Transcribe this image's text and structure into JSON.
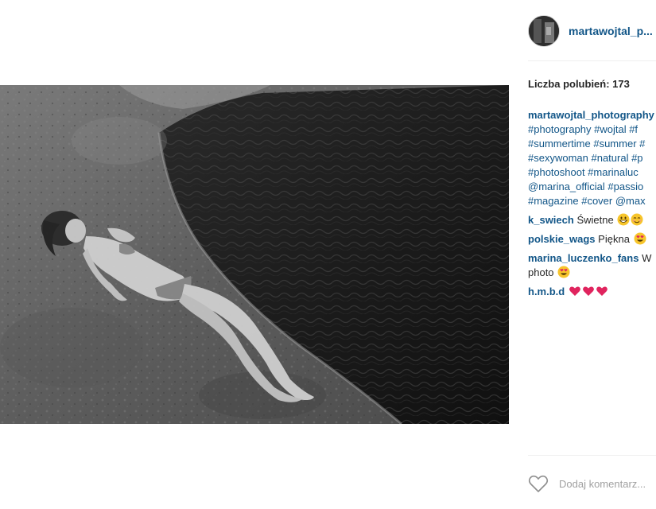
{
  "post": {
    "username": "martawojtal_p...",
    "likes_label": "Liczba polubień: 173",
    "caption_lines": [
      "martawojtal_photography",
      "#photography #wojtal #f",
      "#summertime #summer #",
      "#sexywoman #natural #p",
      "#photoshoot #marinaluc",
      "@marina_official #passio",
      "#magazine #cover @max"
    ],
    "comments": [
      {
        "user": "k_swiech",
        "text": "Świetne",
        "emoji": [
          "grin-emoji",
          "smile-emoji"
        ]
      },
      {
        "user": "polskie_wags",
        "text": "Piękna",
        "emoji": [
          "heart-eyes-emoji"
        ]
      },
      {
        "user": "marina_luczenko_fans",
        "text": "W",
        "text2": "photo",
        "emoji": [
          "heart-eyes-emoji"
        ]
      },
      {
        "user": "h.m.b.d",
        "text": "",
        "emoji": [
          "red-heart-emoji",
          "red-heart-emoji",
          "red-heart-emoji"
        ]
      }
    ],
    "comment_placeholder": "Dodaj komentarz...",
    "colors": {
      "username": "#125688",
      "text": "#262626",
      "placeholder": "#a0a0a0",
      "divider": "#efefef"
    },
    "icons": {
      "like": "heart-outline-icon"
    }
  }
}
